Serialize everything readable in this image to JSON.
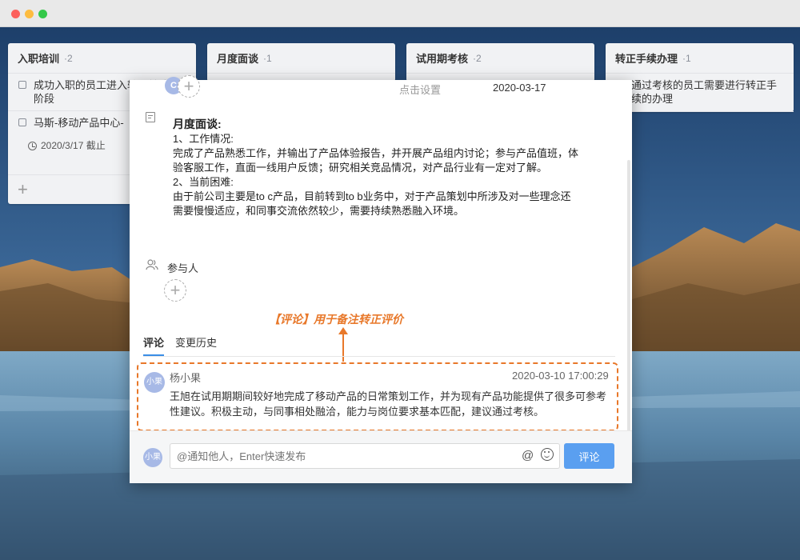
{
  "window": {
    "traffic_lights": [
      "close",
      "minimize",
      "zoom"
    ]
  },
  "columns": [
    {
      "title": "入职培训",
      "count": "·2",
      "tasks": [
        {
          "text": "成功入职的员工进入转正前培训阶段",
          "due": ""
        },
        {
          "text": "马斯-移动产品中心-",
          "due": "2020/3/17 截止"
        }
      ],
      "add_label": "+"
    },
    {
      "title": "月度面谈",
      "count": "·1"
    },
    {
      "title": "试用期考核",
      "count": "·2"
    },
    {
      "title": "转正手续办理",
      "count": "·1",
      "tasks": [
        {
          "text": "通过考核的员工需要进行转正手续的办理"
        }
      ]
    }
  ],
  "dialog": {
    "avatar_initials": "C",
    "add_label": "+",
    "hint": "点击设置",
    "date": "2020-03-17",
    "description": {
      "heading": "月度面谈:",
      "lines": [
        "1、工作情况:",
        "完成了产品熟悉工作，并输出了产品体验报告，并开展产品组内讨论；参与产品值班，体验客服工作，直面一线用户反馈；研究相关竞品情况，对产品行业有一定对了解。",
        "2、当前困难:",
        "由于前公司主要是to c产品，目前转到to b业务中，对于产品策划中所涉及对一些理念还需要慢慢适应，和同事交流依然较少，需要持续熟悉融入环境。"
      ]
    },
    "participants_label": "参与人",
    "annotation": "【评论】用于备注转正评价",
    "tabs": [
      "评论",
      "变更历史"
    ],
    "comment": {
      "avatar": "小果",
      "author": "杨小果",
      "time": "2020-03-10 17:00:29",
      "text": "王旭在试用期期间较好地完成了移动产品的日常策划工作，并为现有产品功能提供了很多可参考性建议。积极主动，与同事相处融洽，能力与岗位要求基本匹配，建议通过考核。"
    },
    "footer": {
      "avatar": "小果",
      "placeholder": "@通知他人，Enter快速发布",
      "at_symbol": "@",
      "send_label": "评论"
    }
  },
  "colors": {
    "accent": "#5a9ff0",
    "annotation": "#e8782a",
    "tab_underline": "#3a8ee6"
  }
}
